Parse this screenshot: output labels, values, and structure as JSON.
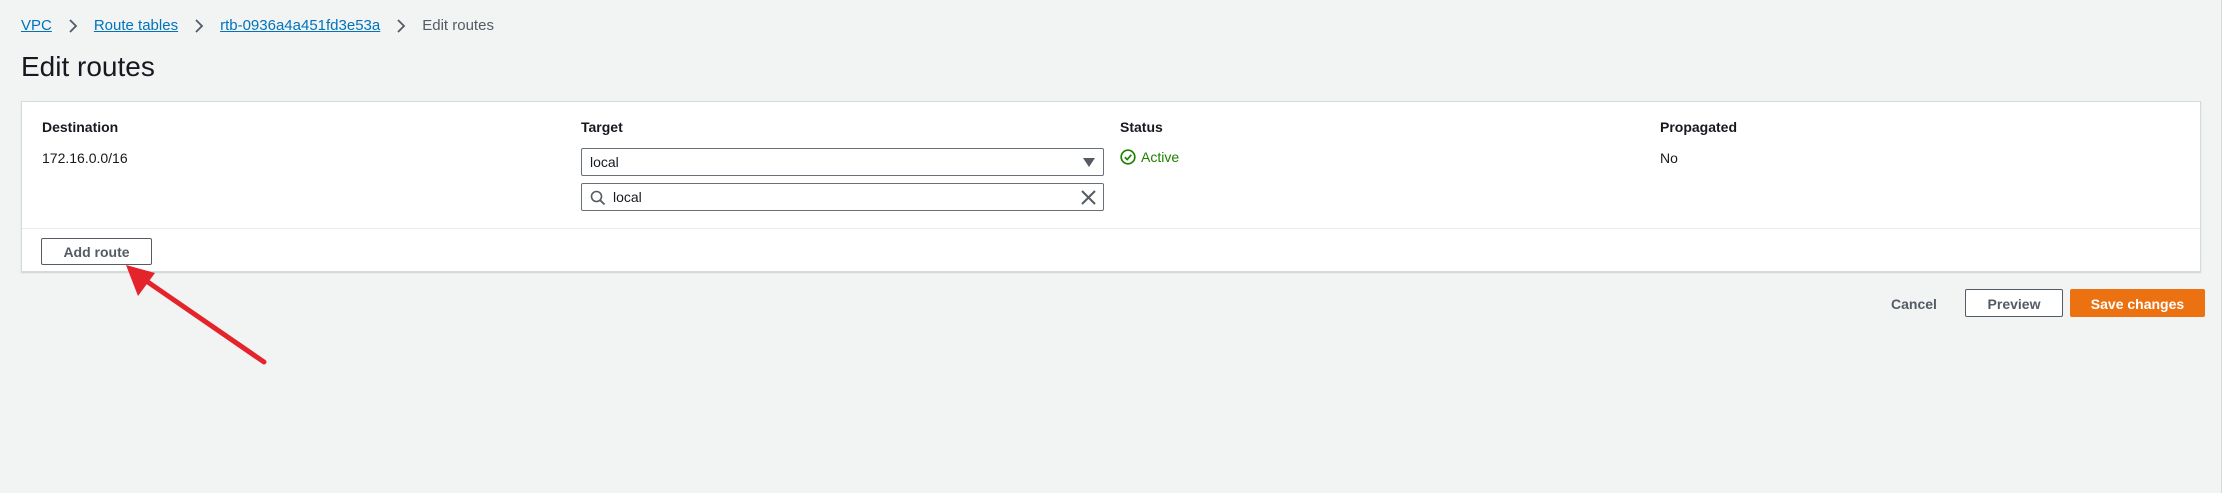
{
  "breadcrumb": {
    "items": [
      {
        "label": "VPC"
      },
      {
        "label": "Route tables"
      },
      {
        "label": "rtb-0936a4a451fd3e53a"
      }
    ],
    "current": "Edit routes"
  },
  "page": {
    "title": "Edit routes"
  },
  "routes_table": {
    "headers": {
      "destination": "Destination",
      "target": "Target",
      "status": "Status",
      "propagated": "Propagated"
    },
    "rows": [
      {
        "destination": "172.16.0.0/16",
        "target_selected": "local",
        "target_filter_value": "local",
        "status": "Active",
        "propagated": "No"
      }
    ]
  },
  "actions": {
    "add_route": "Add route",
    "cancel": "Cancel",
    "preview": "Preview",
    "save_changes": "Save changes"
  },
  "colors": {
    "link": "#0073bb",
    "status_active": "#1d8102",
    "primary_button": "#ec7211",
    "annotation_arrow": "#e3242b"
  },
  "icons": {
    "breadcrumb_separator": "chevron-right-icon",
    "dropdown": "caret-down-icon",
    "search": "search-icon",
    "clear": "close-icon",
    "status": "check-circle-icon"
  }
}
